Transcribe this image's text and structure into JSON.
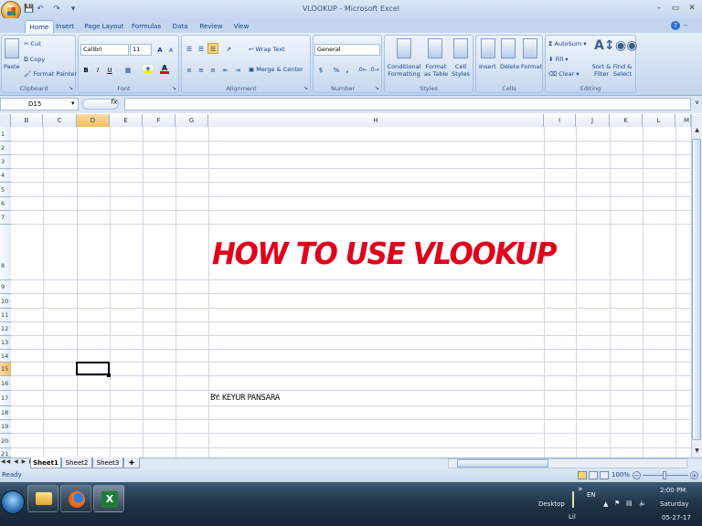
{
  "window": {
    "title": "VLOOKUP - Microsoft Excel"
  },
  "ribbon": {
    "tabs": [
      "Home",
      "Insert",
      "Page Layout",
      "Formulas",
      "Data",
      "Review",
      "View"
    ],
    "active_tab": "Home",
    "clipboard": {
      "paste": "Paste",
      "cut": "Cut",
      "copy": "Copy",
      "format_painter": "Format Painter",
      "label": "Clipboard"
    },
    "font": {
      "name": "Calibri",
      "size": "11",
      "bold": "B",
      "italic": "I",
      "underline": "U",
      "grow": "A",
      "shrink": "A",
      "label": "Font"
    },
    "alignment": {
      "wrap_text": "Wrap Text",
      "merge_center": "Merge & Center",
      "label": "Alignment"
    },
    "number": {
      "format": "General",
      "currency": "$",
      "percent": "%",
      "comma": ",",
      "label": "Number"
    },
    "styles": {
      "conditional": [
        "Conditional",
        "Formatting"
      ],
      "format_table": [
        "Format",
        "as Table"
      ],
      "cell_styles": [
        "Cell",
        "Styles"
      ],
      "label": "Styles"
    },
    "cells": {
      "insert": "Insert",
      "delete": "Delete",
      "format": "Format",
      "label": "Cells"
    },
    "editing": {
      "autosum": "AutoSum",
      "fill": "Fill",
      "clear": "Clear",
      "sort_filter": [
        "Sort &",
        "Filter"
      ],
      "find_select": [
        "Find &",
        "Select"
      ],
      "label": "Editing"
    }
  },
  "formula_bar": {
    "name_box": "D15",
    "fx": "fx",
    "value": ""
  },
  "grid": {
    "columns": [
      "B",
      "C",
      "D",
      "E",
      "F",
      "G",
      "H",
      "I",
      "J",
      "K",
      "L",
      "M"
    ],
    "rows": [
      "1",
      "2",
      "3",
      "4",
      "5",
      "6",
      "7",
      "8",
      "9",
      "10",
      "11",
      "12",
      "13",
      "14",
      "15",
      "16",
      "17",
      "18",
      "19",
      "20",
      "21"
    ],
    "active_cell": "D15",
    "cells": {
      "H8": "HOW TO USE VLOOKUP",
      "H17": "BY: KEYUR PANSARA"
    }
  },
  "sheets": {
    "tabs": [
      "Sheet1",
      "Sheet2",
      "Sheet3"
    ],
    "active": "Sheet1"
  },
  "status": {
    "mode": "Ready",
    "zoom": "100%"
  },
  "taskbar": {
    "desktop": "Desktop",
    "language": "EN",
    "lil": "Lil",
    "time": "2:00 PM",
    "day": "Saturday",
    "date": "05-27-17"
  },
  "colors": {
    "heading": "#e0001b",
    "ribbon": "#cadaf0",
    "taskbar": "#1f3346"
  }
}
